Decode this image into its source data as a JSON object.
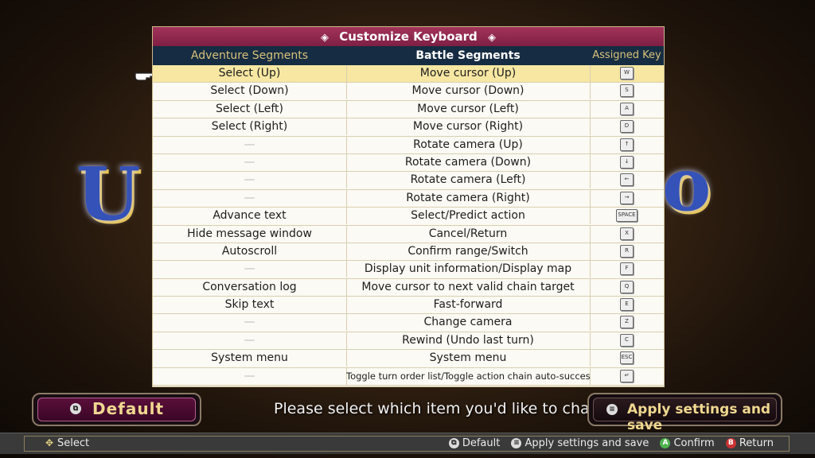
{
  "dialog": {
    "title": "Customize Keyboard",
    "title_ornament": "◈",
    "headers": {
      "adventure": "Adventure Segments",
      "battle": "Battle Segments",
      "key": "Assigned Key"
    },
    "rows": [
      {
        "adventure": "Select (Up)",
        "battle": "Move cursor (Up)",
        "key": "W",
        "selected": true
      },
      {
        "adventure": "Select (Down)",
        "battle": "Move cursor (Down)",
        "key": "S"
      },
      {
        "adventure": "Select (Left)",
        "battle": "Move cursor (Left)",
        "key": "A"
      },
      {
        "adventure": "Select (Right)",
        "battle": "Move cursor (Right)",
        "key": "D"
      },
      {
        "adventure": "—",
        "battle": "Rotate camera (Up)",
        "key": "↑"
      },
      {
        "adventure": "—",
        "battle": "Rotate camera (Down)",
        "key": "↓"
      },
      {
        "adventure": "—",
        "battle": "Rotate camera (Left)",
        "key": "←"
      },
      {
        "adventure": "—",
        "battle": "Rotate camera (Right)",
        "key": "→"
      },
      {
        "adventure": "Advance text",
        "battle": "Select/Predict action",
        "key": "SPACE"
      },
      {
        "adventure": "Hide message window",
        "battle": "Cancel/Return",
        "key": "X"
      },
      {
        "adventure": "Autoscroll",
        "battle": "Confirm range/Switch",
        "key": "R"
      },
      {
        "adventure": "—",
        "battle": "Display unit information/Display map",
        "key": "F"
      },
      {
        "adventure": "Conversation log",
        "battle": "Move cursor to next valid chain target",
        "key": "Q"
      },
      {
        "adventure": "Skip text",
        "battle": "Fast-forward",
        "key": "E"
      },
      {
        "adventure": "—",
        "battle": "Change camera",
        "key": "Z"
      },
      {
        "adventure": "—",
        "battle": "Rewind (Undo last turn)",
        "key": "C"
      },
      {
        "adventure": "System menu",
        "battle": "System menu",
        "key": "ESC"
      },
      {
        "adventure": "—",
        "battle": "Toggle turn order list/Toggle action chain auto-success",
        "key": "↵"
      }
    ]
  },
  "buttons": {
    "default_label": "Default",
    "apply_label": "Apply settings and save"
  },
  "prompt": "Please select which item you'd like to change.",
  "status_bar": {
    "select": "Select",
    "default": "Default",
    "apply": "Apply settings and save",
    "confirm": "Confirm",
    "return": "Return",
    "confirm_key": "A",
    "return_key": "B"
  },
  "colors": {
    "title_bar": "#8e2750",
    "header_bg": "#162c42",
    "selected_row": "#f7e7a2",
    "gold_text": "#f0d890"
  }
}
